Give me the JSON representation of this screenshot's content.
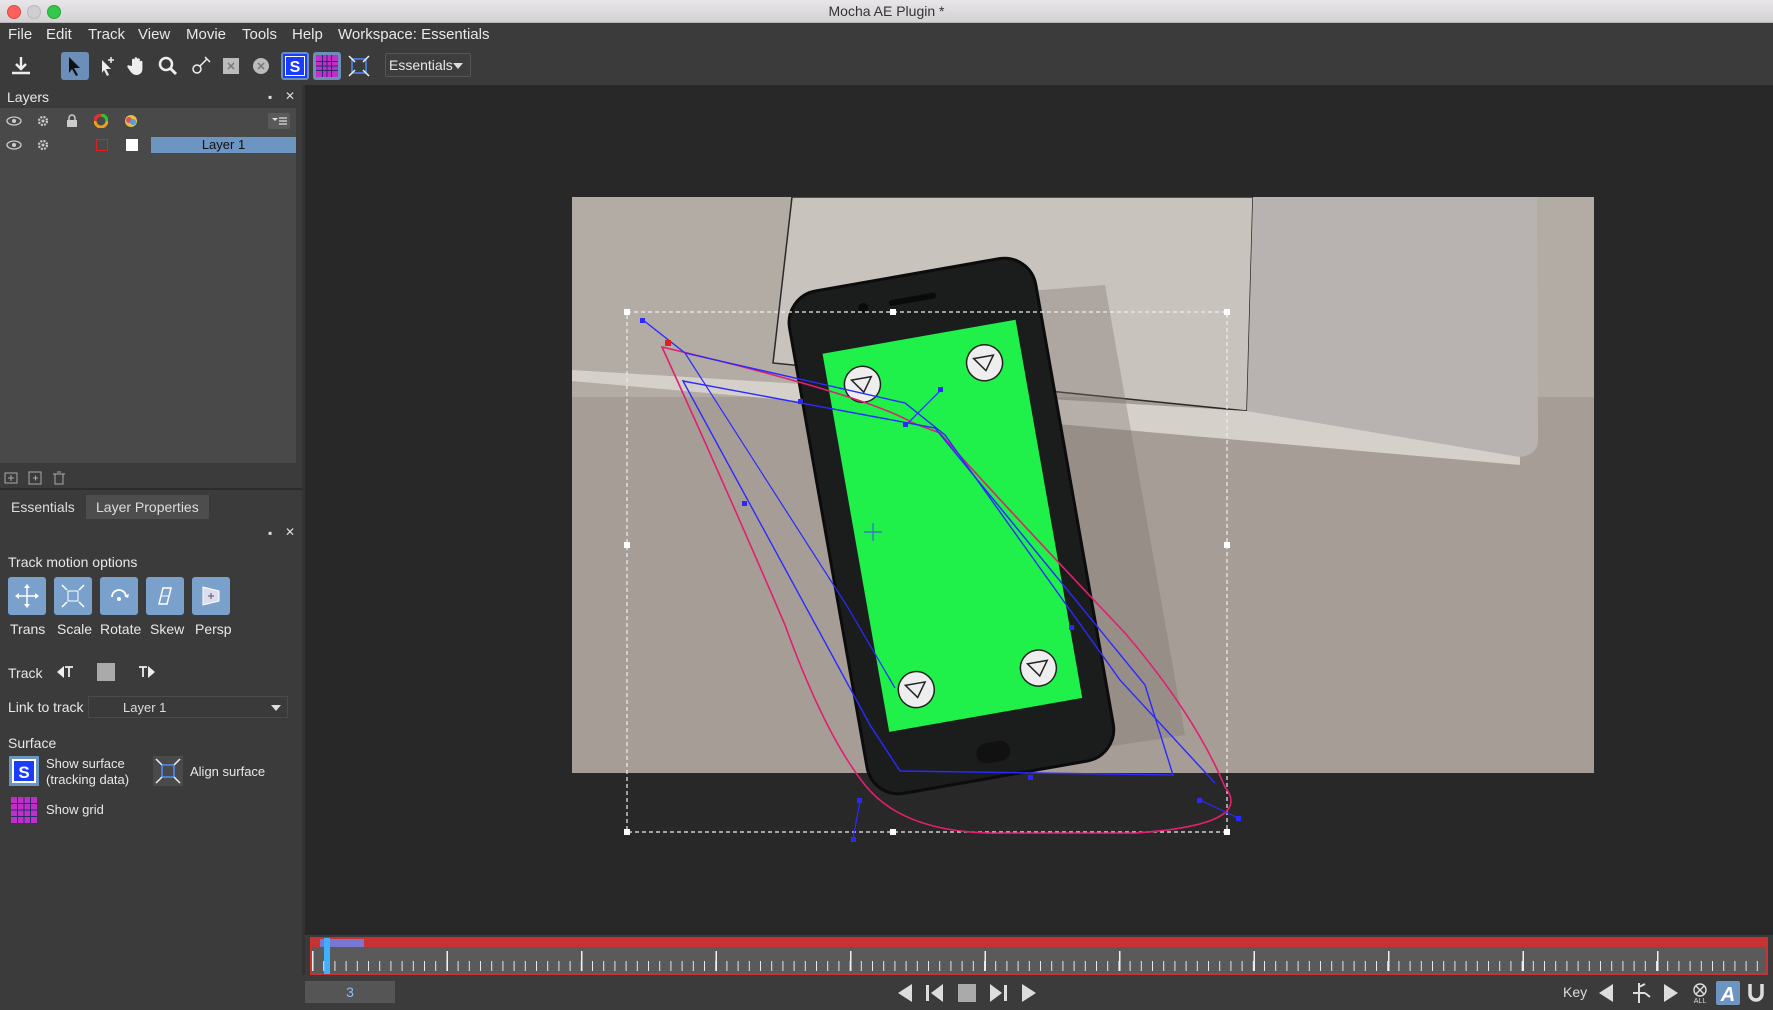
{
  "window": {
    "title": "Mocha AE Plugin *"
  },
  "menu": [
    "File",
    "Edit",
    "Track",
    "View",
    "Movie",
    "Tools",
    "Help",
    "Workspace: Essentials"
  ],
  "toolbar": {
    "workspace": "Essentials"
  },
  "layers_panel": {
    "title": "Layers",
    "layers": [
      {
        "name": "Layer 1"
      }
    ]
  },
  "tabs": [
    {
      "label": "Essentials"
    },
    {
      "label": "Layer Properties"
    }
  ],
  "properties": {
    "track_motion_options": "Track motion options",
    "motion_buttons": [
      "Trans",
      "Scale",
      "Rotate",
      "Skew",
      "Persp"
    ],
    "track_label": "Track",
    "link_to_track_label": "Link to track",
    "link_to_track_value": "Layer 1",
    "surface_label": "Surface",
    "show_surface_line1": "Show surface",
    "show_surface_line2": "(tracking data)",
    "align_surface": "Align surface",
    "show_grid": "Show grid"
  },
  "timeline": {
    "current_frame": "3"
  },
  "transport": {
    "key_label": "Key"
  },
  "colors": {
    "accent": "#6d95c2",
    "screen_green": "#1ff04a",
    "tracking_blue": "#2a2aff",
    "tracking_magenta": "#e0206e",
    "timeline_red": "#c83232"
  }
}
